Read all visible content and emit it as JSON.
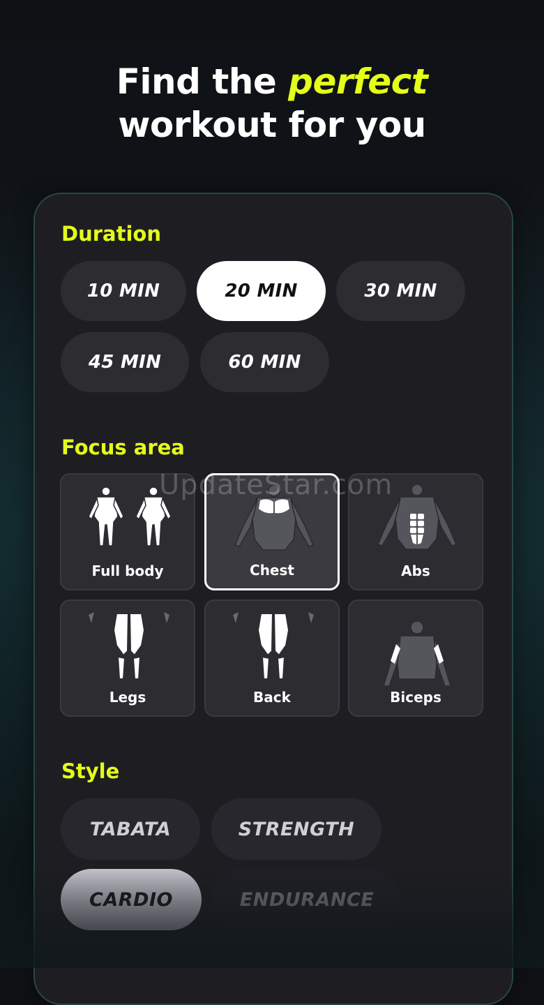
{
  "headline": {
    "line1_prefix": "Find the ",
    "line1_accent": "perfect",
    "line2": "workout for you"
  },
  "duration": {
    "title": "Duration",
    "options": [
      "10 MIN",
      "20 MIN",
      "30 MIN",
      "45 MIN",
      "60 MIN"
    ],
    "selected": "20 MIN"
  },
  "focus": {
    "title": "Focus area",
    "options": [
      {
        "label": "Full body",
        "icon": "full-body-icon"
      },
      {
        "label": "Chest",
        "icon": "chest-icon"
      },
      {
        "label": "Abs",
        "icon": "abs-icon"
      },
      {
        "label": "Legs",
        "icon": "legs-icon"
      },
      {
        "label": "Back",
        "icon": "back-icon"
      },
      {
        "label": "Biceps",
        "icon": "biceps-icon"
      }
    ],
    "selected": "Chest"
  },
  "style": {
    "title": "Style",
    "options": [
      "TABATA",
      "STRENGTH",
      "CARDIO",
      "ENDURANCE"
    ],
    "selected": "CARDIO"
  },
  "watermark": "UpdateStar.com",
  "colors": {
    "accent": "#e4ff1a",
    "card": "#1e1e22",
    "pill": "#2c2c31",
    "border": "#274843"
  }
}
